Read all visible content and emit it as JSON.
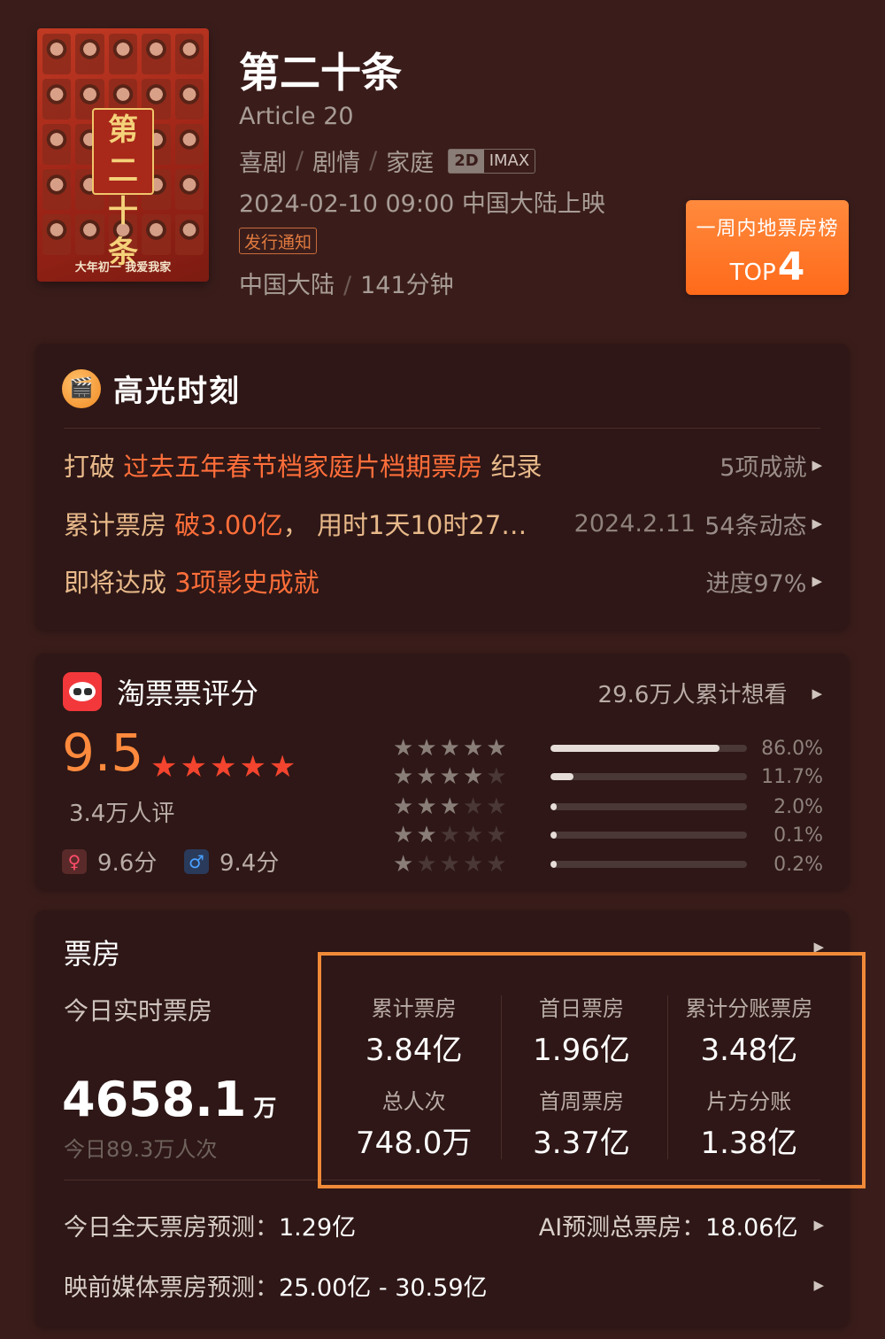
{
  "movie": {
    "poster_title_text": "第二十条",
    "poster_tagline": "大年初一 我爱我家",
    "title": "第二十条",
    "english_title": "Article 20",
    "genres": [
      "喜剧",
      "剧情",
      "家庭"
    ],
    "formats": [
      "2D",
      "IMAX"
    ],
    "release": "2024-02-10 09:00 中国大陆上映",
    "notice": "发行通知",
    "region": "中国大陆",
    "runtime": "141分钟"
  },
  "rank_badge": {
    "title": "一周内地票房榜",
    "prefix": "TOP",
    "rank": "4"
  },
  "highlights": {
    "icon": "film-camera-icon",
    "title": "高光时刻",
    "rows": [
      {
        "text_a": "打破 ",
        "text_hot": "过去五年春节档家庭片档期票房",
        "text_b": " 纪录",
        "date": "",
        "right": "5项成就"
      },
      {
        "text_a": "累计票房 ",
        "text_hot": "破3.00亿",
        "text_b": "， 用时1天10时27…",
        "date": "2024.2.11",
        "right": "54条动态"
      },
      {
        "text_a": "即将达成 ",
        "text_hot": "3项影史成就",
        "text_b": "",
        "date": "",
        "right": "进度97%"
      }
    ]
  },
  "rating": {
    "title": "淘票票评分",
    "want": "29.6万人累计想看",
    "score": "9.5",
    "stars": "★★★★★",
    "count": "3.4万人评",
    "female_score": "9.6分",
    "male_score": "9.4分",
    "distribution": [
      {
        "stars": 5,
        "percent": 86.0,
        "label": "86.0%"
      },
      {
        "stars": 4,
        "percent": 11.7,
        "label": "11.7%"
      },
      {
        "stars": 3,
        "percent": 2.0,
        "label": "2.0%"
      },
      {
        "stars": 2,
        "percent": 0.1,
        "label": "0.1%"
      },
      {
        "stars": 1,
        "percent": 0.2,
        "label": "0.2%"
      }
    ]
  },
  "box_office": {
    "title": "票房",
    "today_label": "今日实时票房",
    "today_value": "4658.1",
    "today_unit": "万",
    "today_people": "今日89.3万人次",
    "stats": [
      {
        "label": "累计票房",
        "value": "3.84亿"
      },
      {
        "label": "首日票房",
        "value": "1.96亿"
      },
      {
        "label": "累计分账票房",
        "value": "3.48亿"
      },
      {
        "label": "总人次",
        "value": "748.0万"
      },
      {
        "label": "首周票房",
        "value": "3.37亿"
      },
      {
        "label": "片方分账",
        "value": "1.38亿"
      }
    ],
    "forecast_today_label": "今日全天票房预测：",
    "forecast_today_value": "1.29亿",
    "ai_forecast_label": "AI预测总票房：",
    "ai_forecast_value": "18.06亿",
    "media_forecast_label": "映前媒体票房预测：",
    "media_forecast_value": "25.00亿 - 30.59亿"
  }
}
